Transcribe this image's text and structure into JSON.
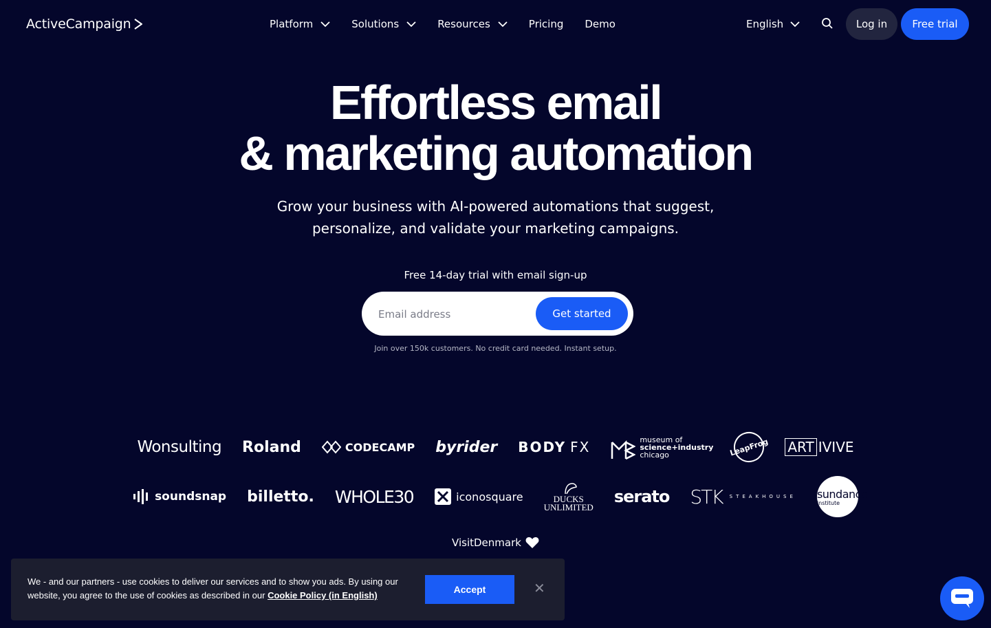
{
  "brand": {
    "name": "ActiveCampaign"
  },
  "nav": {
    "items": [
      {
        "label": "Platform",
        "has_dropdown": true
      },
      {
        "label": "Solutions",
        "has_dropdown": true
      },
      {
        "label": "Resources",
        "has_dropdown": true
      },
      {
        "label": "Pricing",
        "has_dropdown": false
      },
      {
        "label": "Demo",
        "has_dropdown": false
      }
    ],
    "language": "English",
    "search_icon": "search-icon",
    "login_label": "Log in",
    "trial_label": "Free trial"
  },
  "hero": {
    "headline_line1": "Effortless email",
    "headline_line2": "& marketing automation",
    "subheadline_line1": "Grow your business with AI-powered automations that suggest,",
    "subheadline_line2": "personalize, and validate your marketing campaigns.",
    "trial_note": "Free 14-day trial with email sign-up",
    "email_placeholder": "Email address",
    "cta_label": "Get started",
    "join_note": "Join over 150k customers. No credit card needed. Instant setup."
  },
  "customer_logos": {
    "row1": [
      "Wonsulting",
      "Roland",
      "CODECAMP",
      "byrider",
      "BODY FX",
      "museum of science+industry chicago",
      "Leap Frog",
      "ARTIVIVE"
    ],
    "row2": [
      "soundsnap",
      "billetto.",
      "WHOLE30",
      "iconosquare",
      "DUCKS UNLIMITED",
      "serato",
      "STK STEAKHOUSE",
      "sundance institute"
    ],
    "row3": [
      "VisitDenmark"
    ],
    "texts": {
      "wonsulting": "Wonsulting",
      "roland": "Roland",
      "codecamp": "CODECAMP",
      "byrider": "byrider",
      "bodyfx_1": "BODY",
      "bodyfx_2": "FX",
      "museum_1": "museum of",
      "museum_2": "science+industry",
      "museum_3": "chicago",
      "leapfrog_1": "Leap",
      "leapfrog_2": "Frog",
      "artivive_1": "ART",
      "artivive_2": "IVIVE",
      "soundsnap": "soundsnap",
      "billetto": "billetto.",
      "whole30": "WHOLE30",
      "iconosquare": "iconosquare",
      "ducks_1": "DUCKS",
      "ducks_2": "UNLIMITED",
      "serato": "serato",
      "stk_1": "STK",
      "stk_2": "STEAKHOUSE",
      "sundance_1": "sundance",
      "sundance_2": "institute",
      "visitdenmark": "VisitDenmark"
    }
  },
  "cookie_banner": {
    "text": "We - and our partners - use cookies to deliver our services and to show you ads. By using our website, you agree to the use of cookies as described in our",
    "link_label": "Cookie Policy (in English)",
    "accept_label": "Accept",
    "close_icon": "close-icon"
  },
  "chat": {
    "icon": "chat-bubble-icon"
  },
  "colors": {
    "background": "#04062b",
    "accent_blue": "#1a5cf6",
    "login_bg": "#22253f",
    "cookie_bg": "#1c1e2f"
  }
}
